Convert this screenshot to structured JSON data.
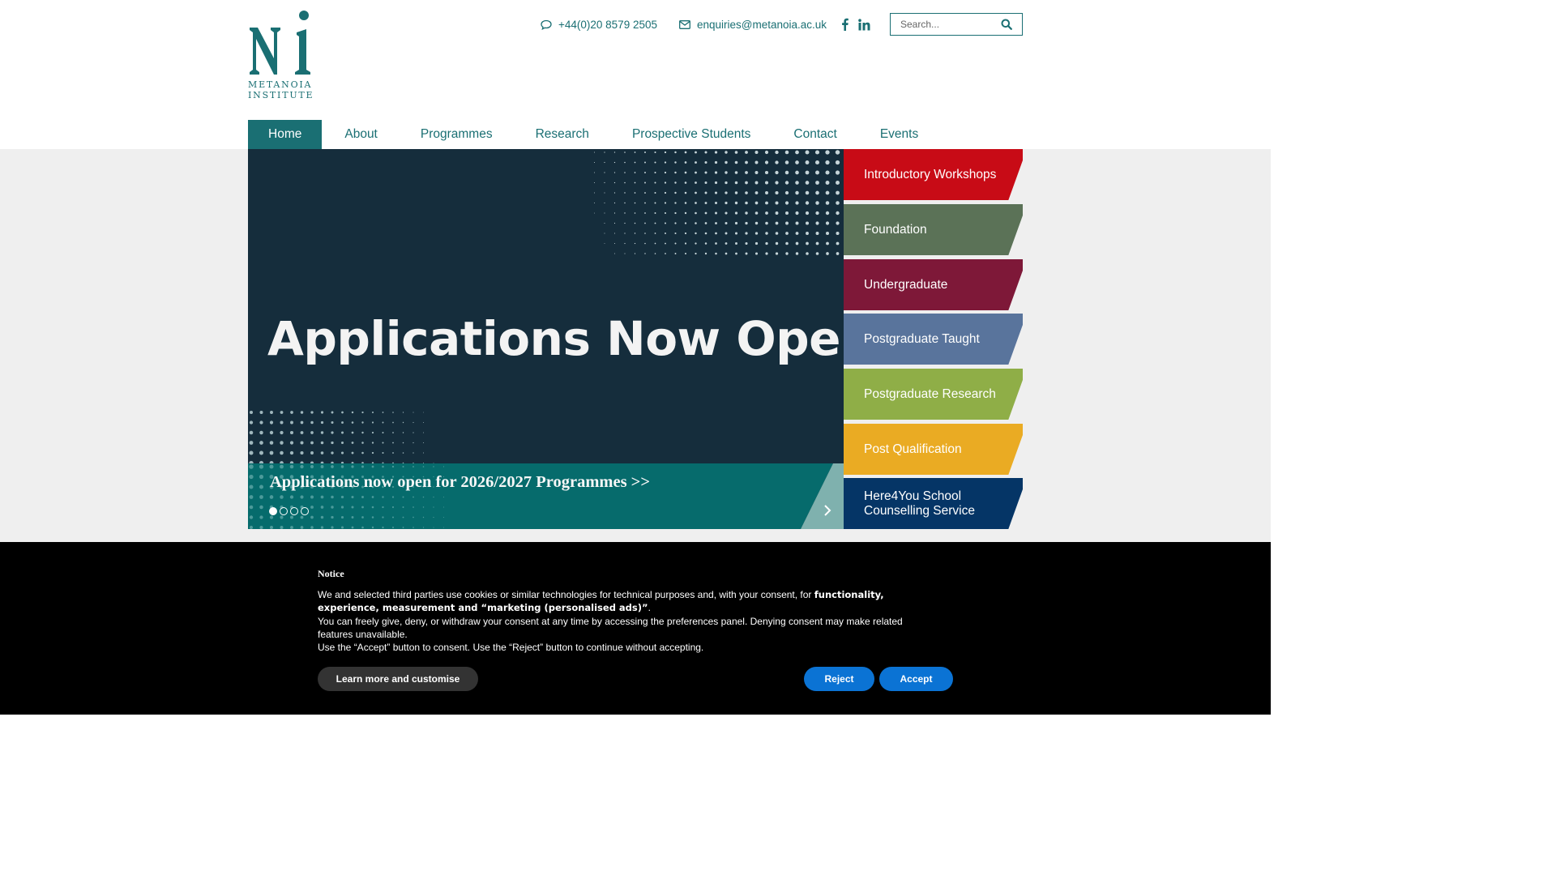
{
  "brand": {
    "logo_line1": "METANOIA",
    "logo_line2": "INSTITUTE",
    "logo_icon": "metanoia-ni-logo",
    "primary_color": "#1a6f73"
  },
  "header": {
    "phone": "+44(0)20 8579 2505",
    "email": "enquiries@metanoia.ac.uk",
    "social": [
      "facebook-icon",
      "linkedin-icon"
    ],
    "search_placeholder": "Search..."
  },
  "nav": {
    "items": [
      {
        "label": "Home",
        "active": true
      },
      {
        "label": "About"
      },
      {
        "label": "Programmes"
      },
      {
        "label": "Research"
      },
      {
        "label": "Prospective Students"
      },
      {
        "label": "Contact"
      },
      {
        "label": "Events"
      }
    ]
  },
  "hero": {
    "title": "Applications Now Open.",
    "caption": "Applications now open for 2026/2027 Programmes >>",
    "slide_count": 4,
    "active_slide": 1,
    "background": "#152d3c",
    "bar_color": "#066b6c"
  },
  "categories": [
    {
      "label": "Introductory Workshops",
      "color": "#c80b16"
    },
    {
      "label": "Foundation",
      "color": "#5b7257"
    },
    {
      "label": "Undergraduate",
      "color": "#7e1838"
    },
    {
      "label": "Postgraduate Taught",
      "color": "#59749c"
    },
    {
      "label": "Postgraduate Research",
      "color": "#8fae47"
    },
    {
      "label": "Post Qualification",
      "color": "#eaab23"
    },
    {
      "label": "Here4You School Counselling Service",
      "color": "#053566"
    }
  ],
  "cookie_notice": {
    "title": "Notice",
    "para1_prefix": "We and selected third parties use cookies or similar technologies for technical purposes and, with your consent, for ",
    "para1_bold": "functionality, experience, measurement and “marketing (personalised ads)”",
    "para1_suffix": ".",
    "para2": "You can freely give, deny, or withdraw your consent at any time by accessing the preferences panel. Denying consent may make related features unavailable.",
    "para3": "Use the “Accept” button to consent. Use the “Reject” button to continue without accepting.",
    "learn_more_label": "Learn more and customise",
    "reject_label": "Reject",
    "accept_label": "Accept"
  }
}
